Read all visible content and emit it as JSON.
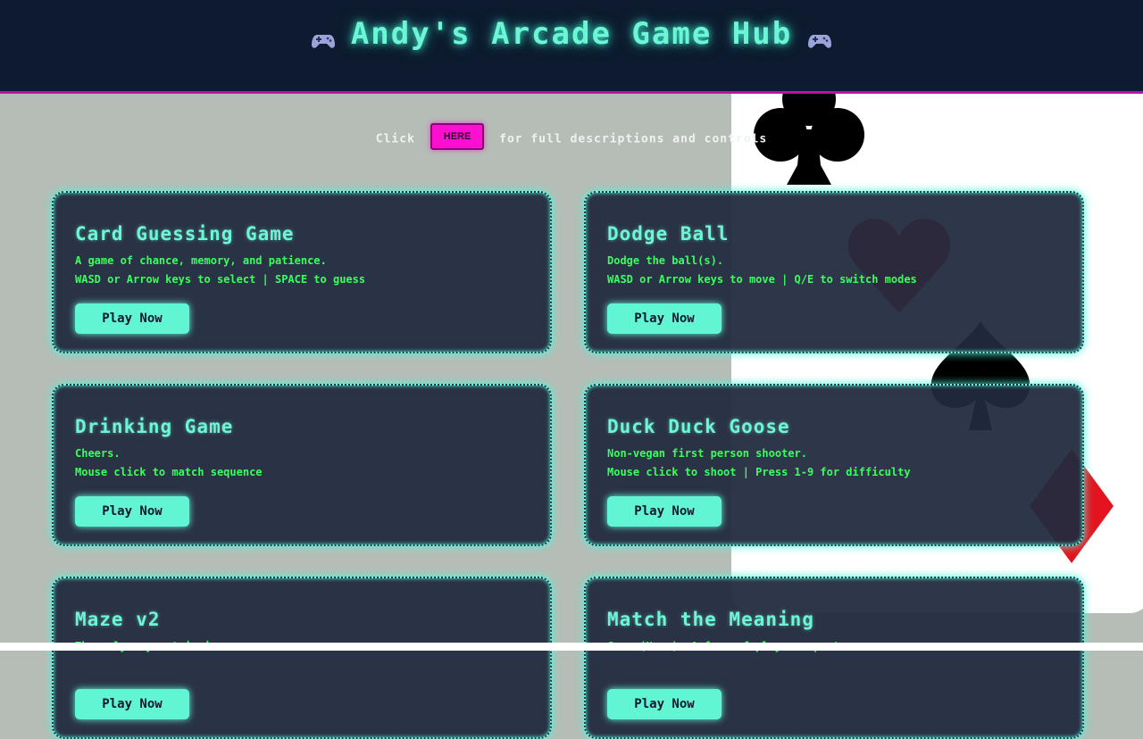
{
  "header": {
    "title": "Andy's Arcade Game Hub",
    "left_icon": "gamepad-icon",
    "right_icon": "gamepad-icon"
  },
  "info": {
    "prefix": "Click",
    "button_label": "HERE",
    "suffix": "for full descriptions and controls"
  },
  "colors": {
    "header_bg": "#0d1a2f",
    "accent_magenta": "#ff0fd0",
    "accent_cyan": "#62f5d3",
    "description_green": "#39ff5e",
    "card_bg": "#212b3f",
    "page_bg": "#b5bdb6"
  },
  "games": [
    {
      "title": "Card Guessing Game",
      "tagline": "A game of chance, memory, and patience.",
      "controls": "WASD or Arrow keys to select | SPACE to guess",
      "button": "Play Now"
    },
    {
      "title": "Dodge Ball",
      "tagline": "Dodge the ball(s).",
      "controls": "WASD or Arrow keys to move | Q/E to switch modes",
      "button": "Play Now"
    },
    {
      "title": "Drinking Game",
      "tagline": "Cheers.",
      "controls": "Mouse click to match sequence",
      "button": "Play Now"
    },
    {
      "title": "Duck Duck Goose",
      "tagline": "Non-vegan first person shooter.",
      "controls": "Mouse click to shoot | Press 1-9 for difficulty",
      "button": "Play Now"
    },
    {
      "title": "Maze v2",
      "tagline": "The only way out is in.",
      "controls": "",
      "button": "Play Now"
    },
    {
      "title": "Match the Meaning",
      "tagline": "Game (Noun): A form of play or sport.",
      "controls": "",
      "button": "Play Now"
    }
  ]
}
